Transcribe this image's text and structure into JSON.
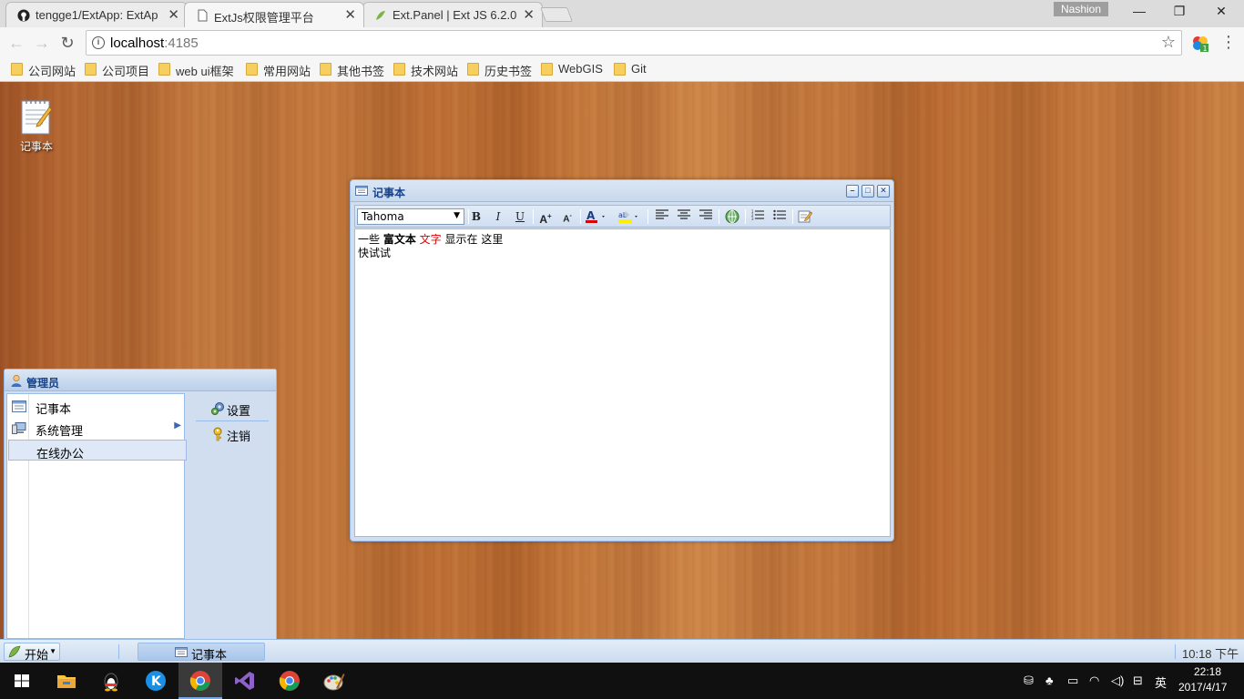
{
  "browser": {
    "profile_name": "Nashion",
    "tabs": [
      {
        "title": "tengge1/ExtApp: ExtAp",
        "icon": "github-icon"
      },
      {
        "title": "ExtJs权限管理平台",
        "icon": "page-icon"
      },
      {
        "title": "Ext.Panel | Ext JS 6.2.0",
        "icon": "sencha-icon"
      }
    ],
    "url_host": "localhost",
    "url_port": ":4185",
    "bookmarks": [
      "公司网站",
      "公司项目",
      "web ui框架",
      "常用网站",
      "其他书签",
      "技术网站",
      "历史书签",
      "WebGIS",
      "Git"
    ]
  },
  "desktop": {
    "icons": [
      {
        "label": "记事本",
        "icon": "notepad-icon"
      }
    ]
  },
  "notepad": {
    "title": "记事本",
    "font": "Tahoma",
    "content": {
      "line1_a": "一些 ",
      "line1_bold": "富文本",
      "line1_space": " ",
      "line1_red": "文字",
      "line1_rest": " 显示在 这里",
      "line2": "快试试"
    },
    "toolbar_buttons": [
      "bold",
      "italic",
      "underline",
      "grow-font",
      "shrink-font",
      "font-color",
      "highlight",
      "align-left",
      "align-center",
      "align-right",
      "link",
      "ordered-list",
      "unordered-list",
      "source-edit"
    ]
  },
  "start_menu": {
    "title": "管理员",
    "items": [
      {
        "label": "记事本",
        "icon": "notepad-icon"
      },
      {
        "label": "系统管理",
        "icon": "computer-icon",
        "submenu": true
      },
      {
        "label": "在线办公",
        "selected": true
      }
    ],
    "tools": [
      {
        "label": "设置",
        "icon": "gear-icon"
      },
      {
        "label": "注销",
        "icon": "key-icon"
      }
    ]
  },
  "ext_taskbar": {
    "start_label": "开始",
    "task_label": "记事本",
    "clock": "10:18 下午"
  },
  "os_taskbar": {
    "time": "22:18",
    "date": "2017/4/17",
    "ime": "英"
  },
  "colors": {
    "ext_title": "#15428b",
    "ext_border": "#99bbe8",
    "red_text": "#dd0000"
  }
}
